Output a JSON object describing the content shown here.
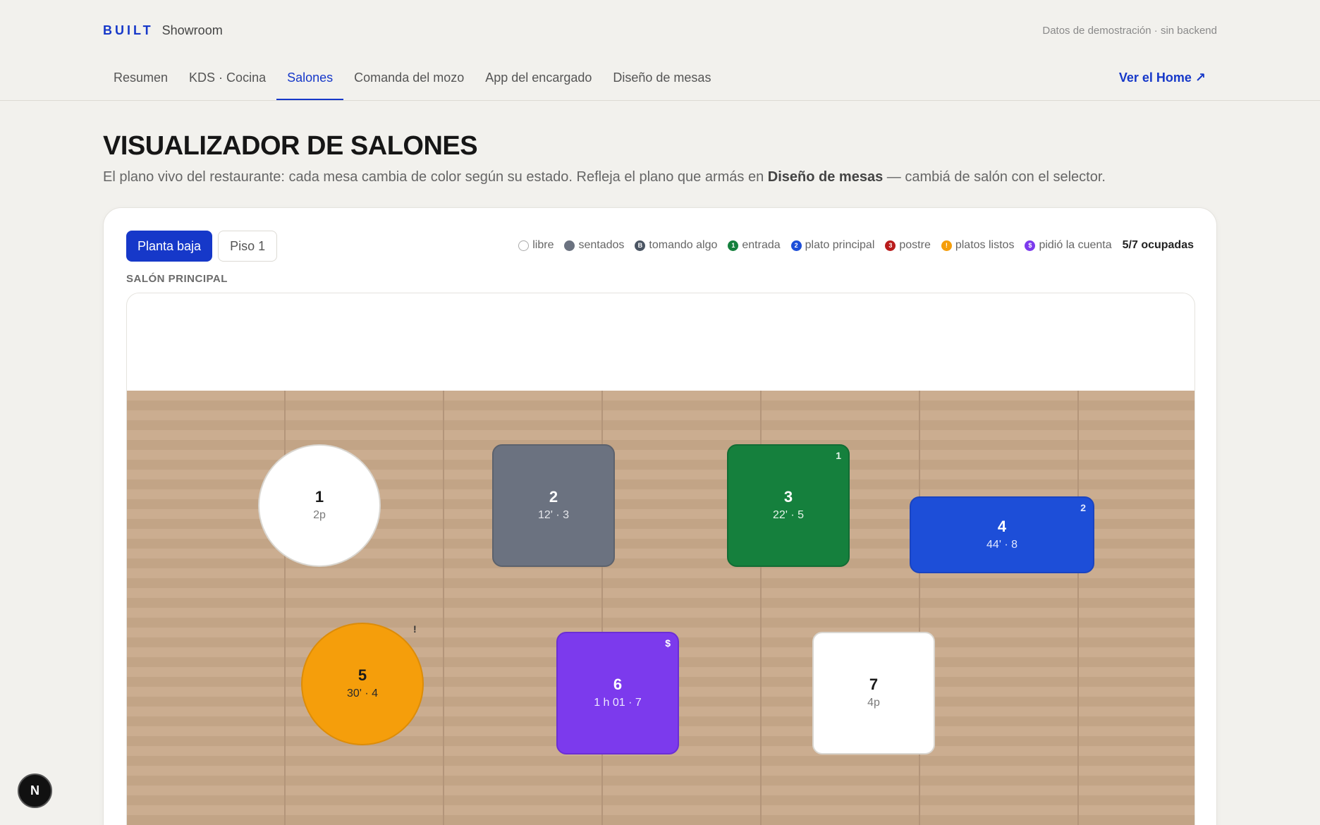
{
  "header": {
    "brand_mark": "BUILT",
    "brand_name": "Showroom",
    "demo_note": "Datos de demostración · sin backend"
  },
  "nav": {
    "tabs": [
      {
        "label": "Resumen",
        "active": false
      },
      {
        "label": "KDS · Cocina",
        "active": false
      },
      {
        "label": "Salones",
        "active": true
      },
      {
        "label": "Comanda del mozo",
        "active": false
      },
      {
        "label": "App del encargado",
        "active": false
      },
      {
        "label": "Diseño de mesas",
        "active": false
      }
    ],
    "home_link": "Ver el Home ↗"
  },
  "page": {
    "title": "VISUALIZADOR DE SALONES",
    "subtitle_before": "El plano vivo del restaurante: cada mesa cambia de color según su estado. Refleja el plano que armás en ",
    "subtitle_bold": "Diseño de mesas",
    "subtitle_after": " — cambiá de salón con el selector."
  },
  "floors": [
    {
      "label": "Planta baja",
      "active": true
    },
    {
      "label": "Piso 1",
      "active": false
    }
  ],
  "legend": [
    {
      "key": "libre",
      "label": "libre",
      "color": "#ffffff",
      "glyph": ""
    },
    {
      "key": "sentados",
      "label": "sentados",
      "color": "#6b7280",
      "glyph": ""
    },
    {
      "key": "tomando",
      "label": "tomando algo",
      "color": "#4b5563",
      "glyph": "B"
    },
    {
      "key": "entrada",
      "label": "entrada",
      "color": "#15803d",
      "glyph": "1"
    },
    {
      "key": "principal",
      "label": "plato principal",
      "color": "#1d4ed8",
      "glyph": "2"
    },
    {
      "key": "postre",
      "label": "postre",
      "color": "#b91c1c",
      "glyph": "3"
    },
    {
      "key": "listos",
      "label": "platos listos",
      "color": "#f59e0b",
      "glyph": "!"
    },
    {
      "key": "cuenta",
      "label": "pidió la cuenta",
      "color": "#7c3aed",
      "glyph": "$"
    }
  ],
  "occupancy": "5/7 ocupadas",
  "room_label": "SALÓN PRINCIPAL",
  "tables": [
    {
      "num": "1",
      "meta": "2p",
      "status": "libre",
      "badge": ""
    },
    {
      "num": "2",
      "meta": "12' · 3",
      "status": "sentados",
      "badge": ""
    },
    {
      "num": "3",
      "meta": "22' · 5",
      "status": "entrada",
      "badge": "1"
    },
    {
      "num": "4",
      "meta": "44' · 8",
      "status": "plato principal",
      "badge": "2"
    },
    {
      "num": "5",
      "meta": "30' · 4",
      "status": "platos listos",
      "badge": "!"
    },
    {
      "num": "6",
      "meta": "1 h 01 · 7",
      "status": "pidió la cuenta",
      "badge": "$"
    },
    {
      "num": "7",
      "meta": "4p",
      "status": "libre",
      "badge": ""
    }
  ],
  "colors": {
    "accent": "#1638c9",
    "libre": "#ffffff",
    "sentados": "#6b7280",
    "entrada": "#15803d",
    "principal": "#1d4ed8",
    "listos": "#f59e0b",
    "cuenta": "#7c3aed",
    "wood": "#c8a98a"
  },
  "dev_badge": "N"
}
